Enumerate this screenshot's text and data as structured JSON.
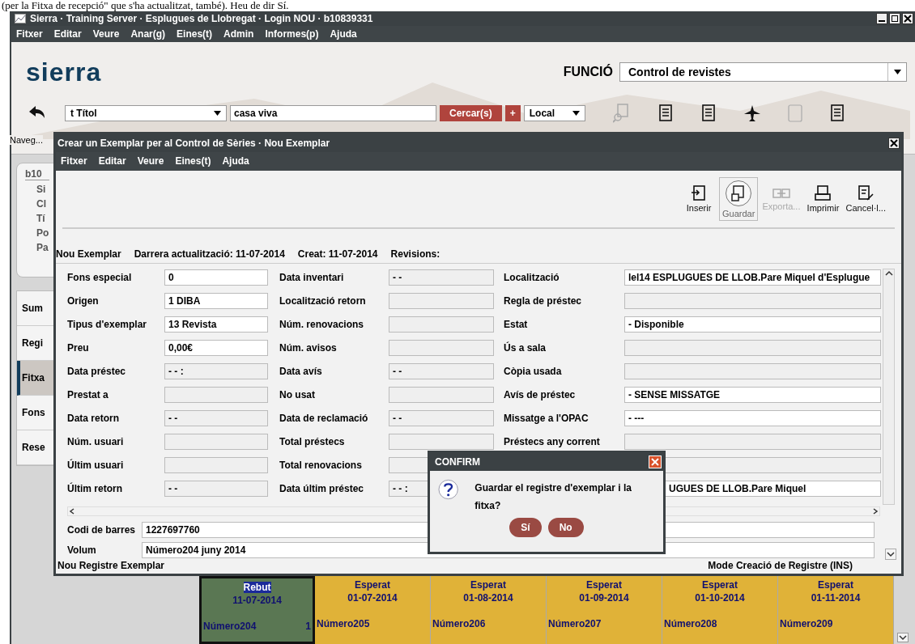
{
  "doc_text": "(per la Fitxa de recepció\" que s'ha actualitzat, també). Heu de dir Sí.",
  "window": {
    "title": "Sierra · Training Server · Esplugues de Llobregat · Login NOU · b10839331"
  },
  "menu": [
    "Fitxer",
    "Editar",
    "Veure",
    "Anar(g)",
    "Eines(t)",
    "Admin",
    "Informes(p)",
    "Ajuda"
  ],
  "logo": "sierra",
  "function": {
    "label": "FUNCIÓ",
    "value": "Control de revistes"
  },
  "search": {
    "back_label": "Naveg...",
    "index": "t Títol",
    "query": "casa viva",
    "search_button": "Cercar(s)",
    "add_button": "+",
    "scope": "Local"
  },
  "toolbar_icons": [
    {
      "kind": "find",
      "disabled": true
    },
    {
      "kind": "doc",
      "disabled": false
    },
    {
      "kind": "doc",
      "disabled": false
    },
    {
      "kind": "plane",
      "disabled": false
    },
    {
      "kind": "blank",
      "disabled": true
    },
    {
      "kind": "doc",
      "disabled": false
    }
  ],
  "record": {
    "id": "b10",
    "fields": [
      "Si",
      "Cl",
      "Tí",
      "Po",
      "Pa"
    ]
  },
  "side_tabs": [
    {
      "label": "Sum",
      "selected": false
    },
    {
      "label": "Regi",
      "selected": false
    },
    {
      "label": "Fitxa",
      "selected": true
    },
    {
      "label": "Fons",
      "selected": false
    },
    {
      "label": "Rese",
      "selected": false
    }
  ],
  "dialog": {
    "title": "Crear un Exemplar per al Control de Sèries · Nou Exemplar",
    "menu": [
      "Fitxer",
      "Editar",
      "Veure",
      "Eines(t)",
      "Ajuda"
    ],
    "tools": [
      {
        "kind": "insert",
        "label": "Inserir",
        "disabled": false,
        "selected": false
      },
      {
        "kind": "save",
        "label": "Guardar",
        "disabled": false,
        "selected": true
      },
      {
        "kind": "export",
        "label": "Exporta...",
        "disabled": true,
        "selected": false
      },
      {
        "kind": "print",
        "label": "Imprimir",
        "disabled": false,
        "selected": false
      },
      {
        "kind": "cancel",
        "label": "Cancel·l...",
        "disabled": false,
        "selected": false
      }
    ],
    "info": [
      "Nou Exemplar",
      "Darrera actualització: 11-07-2014",
      "Creat: 11-07-2014",
      "Revisions:"
    ],
    "left": [
      {
        "label": "Fons especial",
        "value": "0",
        "editable": true
      },
      {
        "label": "Origen",
        "value": "1  DIBA",
        "editable": true
      },
      {
        "label": "Tipus d'exemplar",
        "value": "13  Revista",
        "editable": true
      },
      {
        "label": "Preu",
        "value": "0,00€",
        "editable": true
      },
      {
        "label": "Data préstec",
        "value": "- -      :",
        "editable": false
      },
      {
        "label": "Prestat a",
        "editable": false
      },
      {
        "label": "Data retorn",
        "value": "- -",
        "editable": false
      },
      {
        "label": "Núm. usuari",
        "editable": false
      },
      {
        "label": "Últim usuari",
        "editable": false
      },
      {
        "label": "Últim retorn",
        "value": "- -",
        "editable": false
      }
    ],
    "middle": [
      {
        "label": "Data inventari",
        "value": "- -",
        "editable": false
      },
      {
        "label": "Localització retorn",
        "editable": false
      },
      {
        "label": "Núm. renovacions",
        "editable": false
      },
      {
        "label": "Núm. avisos",
        "editable": false
      },
      {
        "label": "Data avís",
        "value": "- -",
        "editable": false
      },
      {
        "label": "No usat",
        "editable": false
      },
      {
        "label": "Data de reclamació",
        "value": "- -",
        "editable": false
      },
      {
        "label": "Total préstecs",
        "editable": false
      },
      {
        "label": "Total renovacions",
        "editable": false
      },
      {
        "label": "Data últim préstec",
        "value": "- -      :",
        "editable": false
      }
    ],
    "right": [
      {
        "label": "Localització",
        "value": "lel14  ESPLUGUES DE LLOB.Pare Miquel d'Espluguе",
        "editable": true
      },
      {
        "label": "Regla de préstec",
        "editable": false
      },
      {
        "label": "Estat",
        "value": "-  Disponible",
        "editable": true
      },
      {
        "label": "Ús a sala",
        "editable": false
      },
      {
        "label": "Còpia usada",
        "editable": false
      },
      {
        "label": "Avís de préstec",
        "value": "-  SENSE MISSATGE",
        "editable": true
      },
      {
        "label": "Missatge a l'OPAC",
        "value": "-  ---",
        "editable": true
      },
      {
        "label": "Préstecs any corrent",
        "editable": false
      },
      {
        "editable": false
      },
      {
        "value": "UGUES DE LLOB.Pare Miquel",
        "editable": true
      }
    ],
    "bottom": [
      {
        "label": "Codi de barres",
        "value": "1227697760"
      },
      {
        "label": "Volum",
        "value": "Número204 juny 2014"
      }
    ],
    "status_left": "Nou Registre Exemplar",
    "status_right": "Mode Creació de Registre (INS)"
  },
  "confirm": {
    "title": "CONFIRM",
    "message": "Guardar el registre d'exemplar i la fitxa?",
    "buttons": [
      "Sí",
      "No"
    ]
  },
  "issues": [
    {
      "status": "Rebut",
      "date": "11-07-2014",
      "issue": "Número204",
      "count": "1",
      "selected": true
    },
    {
      "status": "Esperat",
      "date": "01-07-2014",
      "issue": "Número205",
      "selected": false
    },
    {
      "status": "Esperat",
      "date": "01-08-2014",
      "issue": "Número206",
      "selected": false
    },
    {
      "status": "Esperat",
      "date": "01-09-2014",
      "issue": "Número207",
      "selected": false
    },
    {
      "status": "Esperat",
      "date": "01-10-2014",
      "issue": "Número208",
      "selected": false
    },
    {
      "status": "Esperat",
      "date": "01-11-2014",
      "issue": "Número209",
      "selected": false
    }
  ]
}
